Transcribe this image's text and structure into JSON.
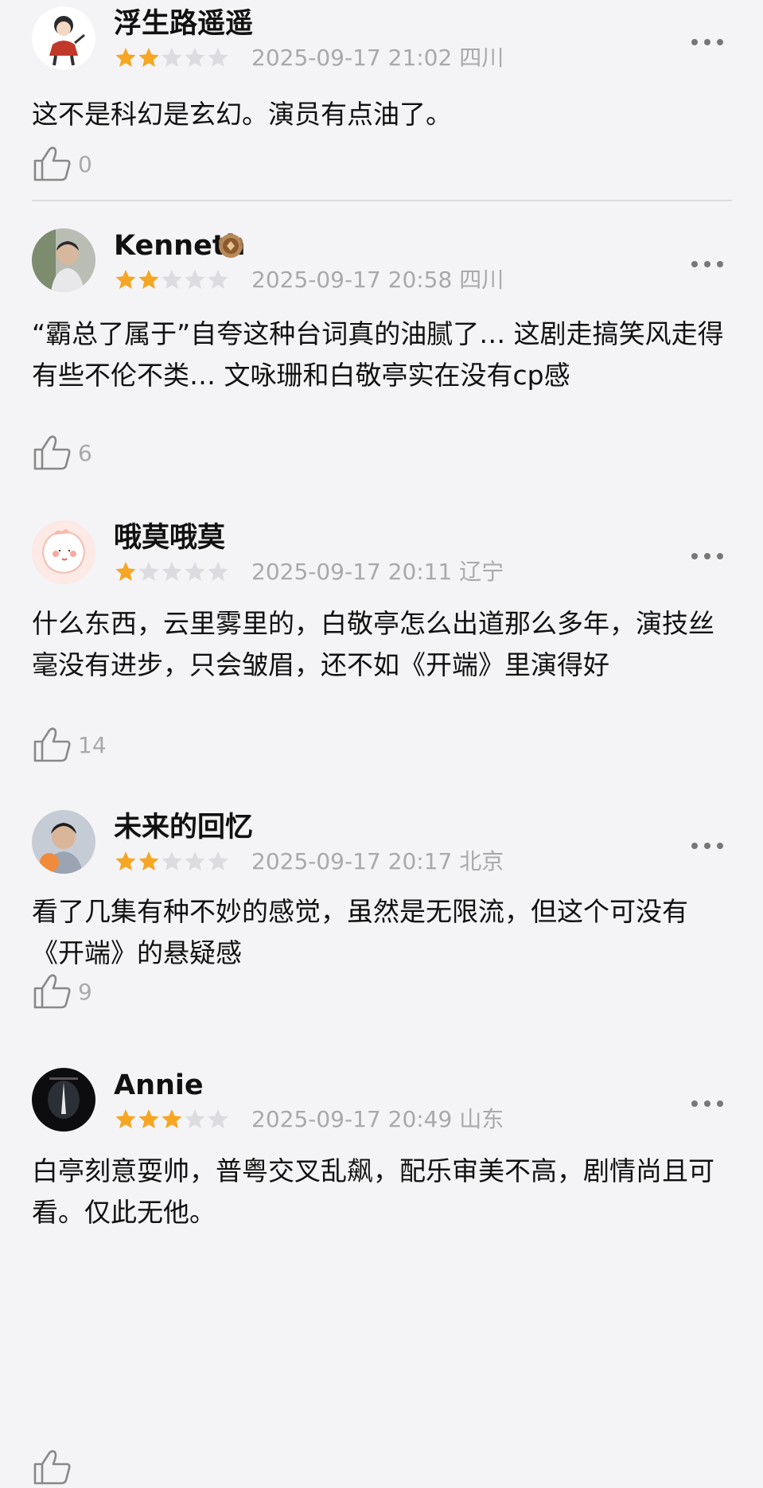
{
  "reviews": [
    {
      "user": "浮生路遥遥",
      "rating": 2,
      "date": "2025-09-17 21:02",
      "location": "四川",
      "text": "这不是科幻是玄幻。演员有点油了。",
      "likes": "0",
      "avatar_icon": "cartoon-child-avatar"
    },
    {
      "user": "Kenneth",
      "rating": 2,
      "date": "2025-09-17 20:58",
      "location": "四川",
      "text": "“霸总了属于”自夸这种台词真的油腻了… 这剧走搞笑风走得有些不伦不类… 文咏珊和白敬亭实在没有cp感",
      "likes": "6",
      "avatar_icon": "person-photo-avatar",
      "badge_icon": "medal-badge-icon"
    },
    {
      "user": "哦莫哦莫",
      "rating": 1,
      "date": "2025-09-17 20:11",
      "location": "辽宁",
      "text": "什么东西，云里雾里的，白敬亭怎么出道那么多年，演技丝毫没有进步，只会皱眉，还不如《开端》里演得好",
      "likes": "14",
      "avatar_icon": "cute-cartoon-avatar"
    },
    {
      "user": "未来的回忆",
      "rating": 2,
      "date": "2025-09-17 20:17",
      "location": "北京",
      "text": "看了几集有种不妙的感觉，虽然是无限流，但这个可没有《开端》的悬疑感",
      "likes": "9",
      "avatar_icon": "selfie-photo-avatar"
    },
    {
      "user": "Annie",
      "rating": 3,
      "date": "2025-09-17 20:49",
      "location": "山东",
      "text": "白亭刻意耍帅，普粤交叉乱飙，配乐审美不高，剧情尚且可看。仅此无他。",
      "likes": "",
      "avatar_icon": "dark-poster-avatar"
    }
  ],
  "colors": {
    "background": "#f4f4f6",
    "star_filled": "#f6a623",
    "star_empty": "#dcdce0",
    "meta_text": "#a9a9ad",
    "divider": "#dcdce0"
  },
  "icons": {
    "more": "more-dots-icon",
    "like": "thumbs-up-icon",
    "star": "star-icon"
  }
}
